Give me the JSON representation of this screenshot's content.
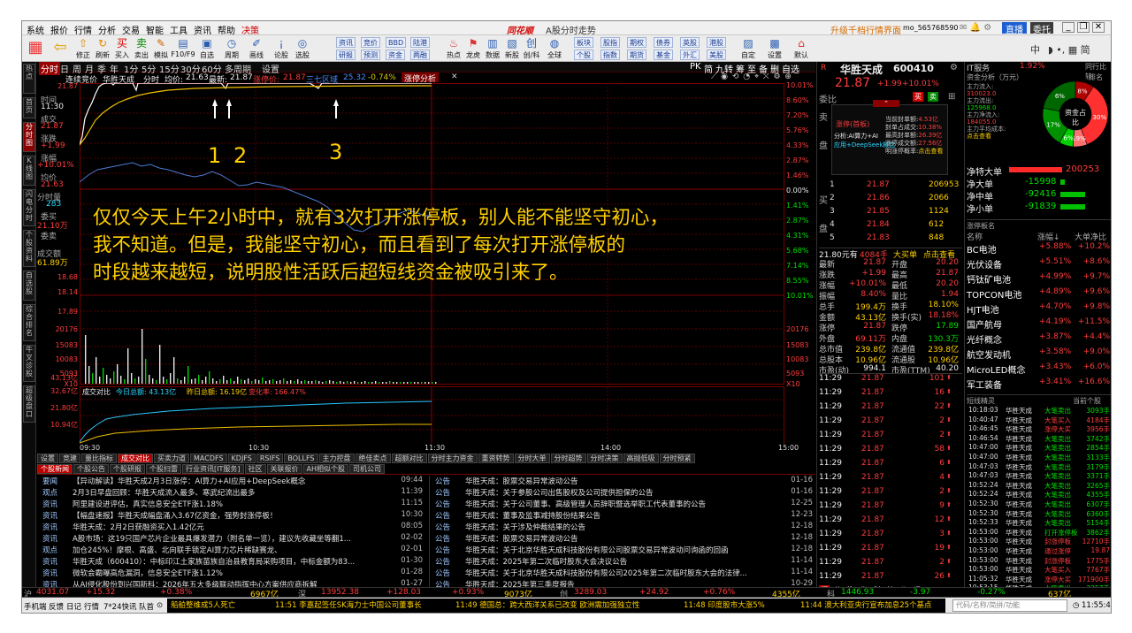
{
  "menu": {
    "items": [
      "系统",
      "报价",
      "行情",
      "分析",
      "交易",
      "智能",
      "工具",
      "资讯",
      "帮助",
      "决策"
    ],
    "logo": "同花顺",
    "title": "A股分时走势",
    "promo": "升级千档行情界面",
    "user": "mo_565768590",
    "btn_direct": "直播",
    "btn_tech": "委托"
  },
  "toolbar": {
    "buttons": [
      "修正",
      "刷新",
      "买入",
      "卖出",
      "模拟",
      "F10/F9",
      "自选",
      "周期",
      "画线",
      "论股",
      "选股"
    ],
    "group1": [
      "资讯",
      "竞价",
      "BBD",
      "陆港",
      "研报",
      "预测",
      "资金",
      "两融"
    ],
    "group2": [
      "热点",
      "龙虎",
      "数据",
      "新股",
      "创/科",
      "全球"
    ],
    "group3": [
      "板块",
      "股指",
      "期权",
      "债券",
      "英股",
      "港股",
      "个股",
      "指数",
      "期货",
      "基金",
      "外汇",
      "美股"
    ],
    "extra": [
      "自定",
      "设置",
      "默认"
    ],
    "right_label": "中"
  },
  "leftnav": [
    "热点",
    "首页",
    "分时图",
    "K线图",
    "闪电分时",
    "个股资料",
    "自选股",
    "综合排名",
    "牛叉诊股",
    "超级盘口"
  ],
  "chart_tabs": {
    "period": [
      "分时",
      "日",
      "周",
      "月",
      "季",
      "年",
      "1分",
      "5分",
      "15分",
      "30分",
      "60分",
      "多周期",
      "设置"
    ],
    "right": [
      "PK",
      "简",
      "九转",
      "筹",
      "至",
      "备",
      "删",
      "自选"
    ]
  },
  "chart_header": {
    "title": "连续竞价",
    "name": "华胜天成",
    "time": "分时",
    "avg_label": "均价:",
    "avg": "21.63",
    "last_label": "最新:",
    "last": "21.87",
    "limit_label": "涨停价:",
    "limit": "21.87",
    "hint": "三七区域",
    "hint_val": "25.32",
    "pct": "-0.74%",
    "tab": "涨停分析"
  },
  "left_panel": {
    "time_label": "时间",
    "time": "11:30",
    "close_label": "成交",
    "close": "21.87",
    "chg_label": "涨跌",
    "chg": "+1.99",
    "pct_label": "涨幅",
    "pct": "+10.01%",
    "avg_label": "均价",
    "avg": "21.63",
    "vol_label": "分时量",
    "vol": "283",
    "bid_label": "委买",
    "bid": "21.10万",
    "ask_label": "委卖",
    "ask": "",
    "amt_label": "成交额",
    "amt": "61.89万"
  },
  "price_axis_left": [
    "21.87",
    "21.34",
    "20.81",
    "20.28",
    "19.74",
    "19.21",
    "18.68",
    "18.14",
    "17.89"
  ],
  "pct_axis_right": [
    "10.01%",
    "8.60%",
    "7.20%",
    "5.76%",
    "4.33%",
    "2.87%",
    "1.46%",
    "0.00%",
    "1.41%",
    "2.87%",
    "4.31%",
    "5.68%",
    "7.14%",
    "8.55%",
    "10.01%"
  ],
  "vol_axis": [
    "20176",
    "15083",
    "10083",
    "5093",
    "X10"
  ],
  "vol_axis_r": [
    "20176",
    "15083",
    "10083",
    "5093",
    "X10"
  ],
  "ind_axis": [
    "43.13亿",
    "32.67亿",
    "21.80亿",
    "10.94亿"
  ],
  "ind_header": {
    "name": "成交对比",
    "today": "今日总额: 43.13亿",
    "yday": "昨日总额: 16.19亿",
    "ratio": "变化率: 166.47%"
  },
  "markers": [
    "1",
    "2",
    "3"
  ],
  "time_axis": [
    "09:30",
    "10:30",
    "11:30",
    "14:00",
    "15:00"
  ],
  "overlay": [
    "仅仅今天上午2小时中，就有3次打开涨停板，别人能不能坚守初心，",
    "我不知道。但是，我能坚守初心，而且看到了每次打开涨停板的",
    "时段越来越短，说明股性活跃后超短线资金被吸引来了。"
  ],
  "indicator_tabs": [
    "设置",
    "竞建",
    "量比指标",
    "成交对比",
    "买卖力道",
    "MACDFS",
    "KDJFS",
    "RSIFS",
    "BOLLFS",
    "主力控盘",
    "绝佳卖点",
    "超额对比",
    "分时主力资金",
    "重资转势",
    "分时大单",
    "分时超势",
    "分时决策",
    "高抛低吸",
    "分时预紧"
  ],
  "news_tabs": [
    "个股新闻",
    "个股公告",
    "个股研报",
    "个股扫雷",
    "行业资讯[IT服务]",
    "社区",
    "关联报价",
    "AH相似个股",
    "司机公司"
  ],
  "news_left": [
    {
      "tag": "要闻",
      "title": "【异动解读】华胜天成2月3日涨停：AI算力+AI应用+DeepSeek概念",
      "time": "09:44"
    },
    {
      "tag": "观点",
      "title": "2月3日早盘回顾：华胜天成流入最多、寒武纪流出最多",
      "time": "11:39"
    },
    {
      "tag": "资讯",
      "title": "阿里建设进评估，真实信息安全ETF涨1.18%",
      "time": "11:15"
    },
    {
      "tag": "资讯",
      "title": "【幅盘速报】华胜天成幅盘涌入3.67亿资金，强势封涨停板！",
      "time": "10:30"
    },
    {
      "tag": "资讯",
      "title": "华胜天成：2月2日获融资买入1.42亿元",
      "time": "08:05"
    },
    {
      "tag": "资讯",
      "title": "A股市场：这19只国产芯片企业最具爆发潜力（附名单一览），建议先收藏坐等翻1...",
      "time": "02-02"
    },
    {
      "tag": "观点",
      "title": "加仓245%！摩根、高盛、北向联手锁定AI算力芯片稀缺赛龙、",
      "time": "02-01"
    },
    {
      "tag": "资讯",
      "title": "华胜天成（600410）：中标印江土家族苗族自治县教育局采购项目，中标金额为83...",
      "time": "01-30"
    },
    {
      "tag": "资讯",
      "title": "微软会霸曝高危漏洞，信息安全ETF涨1.12%",
      "time": "01-28"
    },
    {
      "tag": "资讯",
      "title": "从AI侵化股份到兴国新科：2026年五大多级联动指挥中心方案供应商拆解",
      "time": "01-27"
    }
  ],
  "news_right": [
    {
      "tag": "公告",
      "title": "华胜天成：股票交易异常波动公告",
      "time": "01-16"
    },
    {
      "tag": "公告",
      "title": "华胜天成：关于参股公司出售股权及公司提供担保的公告",
      "time": "01-16"
    },
    {
      "tag": "公告",
      "title": "华胜天成：关于公司董事、高级管理人员辞职暨选举职工代表董事的公告",
      "time": "12-25"
    },
    {
      "tag": "公告",
      "title": "华胜天成：董事及监事减持股份结果公告",
      "time": "12-23"
    },
    {
      "tag": "公告",
      "title": "华胜天成：关于涉及仲裁结果的公告",
      "time": "12-18"
    },
    {
      "tag": "公告",
      "title": "华胜天成：股票交易异常波动公告",
      "time": "12-18"
    },
    {
      "tag": "公告",
      "title": "华胜天成：关于北京华胜天成科技股份有限公司股票交易异常波动问询函的回函",
      "time": "12-18"
    },
    {
      "tag": "公告",
      "title": "华胜天成：2025年第二次临时股东大会决议公告",
      "time": "11-14"
    },
    {
      "tag": "公告",
      "title": "华胜天成：关于北京华胜天成科技股份有限公司2025年第二次临时股东大会的法律...",
      "time": "11-14"
    },
    {
      "tag": "公告",
      "title": "华胜天成：2025年第三季度报告",
      "time": "10-29"
    }
  ],
  "quote": {
    "code": "600410",
    "name": "华胜天成",
    "price": "21.87",
    "chg": "+1.99",
    "pct": "+10.01%",
    "weituo_label": "委比",
    "weituo": "",
    "vol_ratio": "委差",
    "limit_title": "涨停(首板)",
    "fenxi": "分析:AI算力+AI",
    "yingyong": "应用+DeepSeek概念",
    "stats": [
      [
        "当前封单额:",
        "4.53亿"
      ],
      [
        "封单占成交:",
        "10.38%"
      ],
      [
        "最高封单额:",
        "26.39亿"
      ],
      [
        "涨停成交额:",
        "27.56亿"
      ],
      [
        "明涨停概率:",
        "点击查看"
      ]
    ],
    "asks": [
      [
        "1",
        "21.87",
        "206953"
      ],
      [
        "2",
        "21.86",
        "2066"
      ],
      [
        "3",
        "21.85",
        "1124"
      ],
      [
        "4",
        "21.84",
        "612"
      ],
      [
        "5",
        "21.83",
        "848"
      ]
    ],
    "sum_line": [
      "21.80元有",
      "4084手",
      "大买单",
      "点击查看"
    ],
    "detail": [
      [
        "最新",
        "21.87",
        "开盘",
        "20.20"
      ],
      [
        "涨跌",
        "+1.99",
        "最高",
        "21.87"
      ],
      [
        "涨幅",
        "+10.01%",
        "最低",
        "20.20"
      ],
      [
        "振幅",
        "8.40%",
        "量比",
        "1.94"
      ],
      [
        "总手",
        "199.4万",
        "换手",
        "18.10%"
      ],
      [
        "金额",
        "43.13亿",
        "换手(实)",
        "18.18%"
      ],
      [
        "涨停",
        "21.87",
        "跌停",
        "17.89"
      ],
      [
        "外盘",
        "69.11万",
        "内盘",
        "130.3万"
      ],
      [
        "总市值",
        "239.8亿",
        "流通值",
        "239.8亿"
      ],
      [
        "总股本",
        "10.96亿",
        "流通股",
        "10.96亿"
      ],
      [
        "市盈(动)",
        "994.1",
        "市盈(TTM)",
        "40.20"
      ]
    ],
    "ticks": [
      [
        "11:29",
        "21.87",
        "101"
      ],
      [
        "11:29",
        "21.87",
        "16"
      ],
      [
        "11:29",
        "21.87",
        "22"
      ],
      [
        "11:29",
        "21.87",
        "2"
      ],
      [
        "11:29",
        "21.87",
        "2"
      ],
      [
        "11:29",
        "21.87",
        "58"
      ],
      [
        "11:29",
        "21.87",
        "6"
      ],
      [
        "11:29",
        "21.87",
        "4"
      ],
      [
        "11:29",
        "21.87",
        "2"
      ],
      [
        "11:29",
        "21.87",
        "9"
      ],
      [
        "11:29",
        "21.87",
        "12"
      ],
      [
        "11:29",
        "21.87",
        "3"
      ],
      [
        "11:29",
        "21.87",
        "19"
      ],
      [
        "11:29",
        "21.87",
        "2"
      ],
      [
        "11:29",
        "21.87",
        "26"
      ]
    ],
    "tick_tabs": [
      "细",
      "分",
      "K",
      "指",
      "财",
      "情",
      "价",
      "评"
    ]
  },
  "fund": {
    "sector": "IT服务",
    "sector_pct": "1.92%",
    "sector_link": "同行比较",
    "title": "资金分析（万元）",
    "rank": "排名",
    "main_in_label": "主力流入:",
    "main_in": "310023.0",
    "main_out_label": "主力流出:",
    "main_out": "125968.0",
    "main_net_label": "主力净流入:",
    "main_net": "184055.0",
    "cost_label": "主力平均成本:",
    "cost": "点击查看",
    "pie_label": "资金占比",
    "pie": [
      {
        "pct": 8,
        "color": "#b00000"
      },
      {
        "pct": 30,
        "color": "#ff3030"
      },
      {
        "pct": 6,
        "color": "#ff7070"
      },
      {
        "pct": 6,
        "color": "#00d000"
      },
      {
        "pct": 17,
        "color": "#009000"
      },
      {
        "pct": 19,
        "color": "#006600"
      }
    ],
    "pie_texts": [
      "8%",
      "30%",
      "19%",
      "6%",
      "17%",
      "6%",
      "6%"
    ],
    "flows": [
      {
        "label": "净特大单",
        "val": "200253",
        "w": 1.0,
        "color": "#ff2a2a"
      },
      {
        "label": "净大单",
        "val": "-15998",
        "w": 0.08,
        "color": "#00c000"
      },
      {
        "label": "净中单",
        "val": "-92416",
        "w": 0.46,
        "color": "#00c000"
      },
      {
        "label": "净小单",
        "val": "-91839",
        "w": 0.46,
        "color": "#00c000"
      }
    ]
  },
  "sectors": {
    "title": "涨停板名",
    "head": [
      "名称",
      "涨幅↓",
      "大单净比"
    ],
    "rows": [
      [
        "BC电池",
        "+5.88%",
        "+10.2%"
      ],
      [
        "光伏设备",
        "+5.51%",
        "+8.6%"
      ],
      [
        "钙钛矿电池",
        "+4.99%",
        "+9.7%"
      ],
      [
        "TOPCON电池",
        "+4.89%",
        "+9.6%"
      ],
      [
        "HJT电池",
        "+4.70%",
        "+9.8%"
      ],
      [
        "国产航母",
        "+4.19%",
        "+11.5%"
      ],
      [
        "光纤概念",
        "+3.87%",
        "+4.4%"
      ],
      [
        "航空发动机",
        "+3.58%",
        "+9.0%"
      ],
      [
        "MicroLED概念",
        "+3.43%",
        "+6.0%"
      ],
      [
        "军工装备",
        "+3.41%",
        "+16.6%"
      ]
    ]
  },
  "monitor": {
    "title": "短线精灵",
    "right": "当前个股",
    "rows": [
      [
        "10:18:03",
        "华胜天成",
        "大笔卖出",
        "3093手"
      ],
      [
        "10:40:47",
        "华胜天成",
        "大笔买入",
        "4184手"
      ],
      [
        "10:46:45",
        "华胜天成",
        "涨停大买",
        "3956手"
      ],
      [
        "10:46:54",
        "华胜天成",
        "大笔卖出",
        "3742手"
      ],
      [
        "10:47:00",
        "华胜天成",
        "大笔卖出",
        "2854手"
      ],
      [
        "10:47:00",
        "华胜天成",
        "大笔卖出",
        "3133手"
      ],
      [
        "10:47:03",
        "华胜天成",
        "大笔卖出",
        "3179手"
      ],
      [
        "10:47:03",
        "华胜天成",
        "大笔卖出",
        "3371手"
      ],
      [
        "10:52:24",
        "华胜天成",
        "大笔卖出",
        "3265手"
      ],
      [
        "10:52:24",
        "华胜天成",
        "大笔卖出",
        "4355手"
      ],
      [
        "10:52:30",
        "华胜天成",
        "大笔卖出",
        "6307手"
      ],
      [
        "10:52:30",
        "华胜天成",
        "大笔卖出",
        "6360手"
      ],
      [
        "10:52:33",
        "华胜天成",
        "大笔卖出",
        "5154手"
      ],
      [
        "10:53:00",
        "华胜天成",
        "打开涨停板",
        "3862手"
      ],
      [
        "10:53:00",
        "华胜天成",
        "封涨停板",
        "12710手"
      ],
      [
        "10:53:00",
        "华胜天成",
        "通过涨停",
        "19.87"
      ],
      [
        "10:53:00",
        "华胜天成",
        "封涨停板",
        "1775手"
      ],
      [
        "10:53:00",
        "华胜天成",
        "大笔买入",
        "7767手"
      ],
      [
        "11:05:32",
        "华胜天成",
        "涨停大买",
        "171900手"
      ],
      [
        "10:53:15",
        "华胜天成",
        "大笔卖出",
        "2357手"
      ]
    ]
  },
  "indexbar": {
    "sh_label": "沪",
    "sh": "4031.07",
    "sh_chg": "+15.32",
    "sh_pct": "+0.38%",
    "sh_amt": "6967亿",
    "sz_label": "深",
    "sz": "13952.38",
    "sz_chg": "+128.03",
    "sz_pct": "+0.93%",
    "sz_amt": "9073亿",
    "cy_label": "创",
    "cy": "3289.03",
    "cy_chg": "+24.92",
    "cy_pct": "+0.76%",
    "cy_amt": "4355亿",
    "kc_label": "科",
    "kc": "1446.93",
    "kc_chg": "-3.97",
    "kc_pct": "-0.27%",
    "kc_amt": "637亿"
  },
  "statusbar": {
    "items": [
      "手机端",
      "反馈",
      "日记",
      "行情",
      "7*24快讯",
      "队首"
    ],
    "ticker": [
      "船舶整维成5人死亡",
      "11:51 李嘉起签任SK海力士中国公司董事长",
      "11:49 德国总：跨大西洋关系已改变 欧洲需加强独立性",
      "11:48 印度股市大涨5%",
      "11:44 澳大利亚央行宣布加息25个基点"
    ],
    "search": "代码/名称/简拼/功能",
    "clock": "11:55:46"
  }
}
